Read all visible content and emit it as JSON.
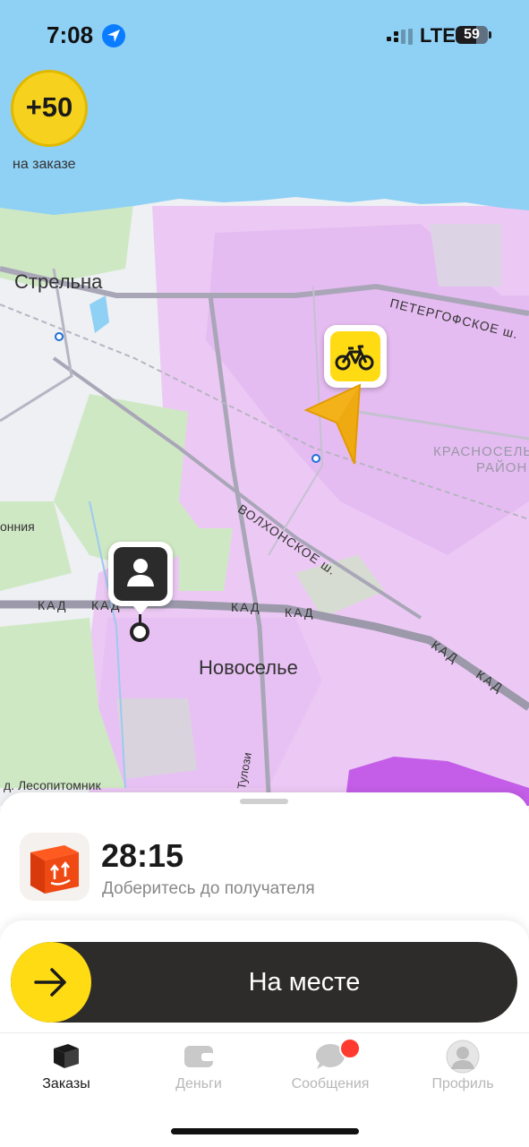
{
  "status_bar": {
    "time": "7:08",
    "network": "LTE",
    "battery": "59",
    "location_icon": "location-arrow-icon",
    "signal_icon": "signal-bars-icon"
  },
  "map": {
    "bonus": {
      "value": "+50",
      "label": "на заказе"
    },
    "places": {
      "strelna": "Стрельна",
      "novoselye": "Новоселье",
      "lesopitomnik": "д. Лесопитомник",
      "monia": "онния",
      "krasnoselsky_1": "КРАСНОСЕЛЬ",
      "krasnoselsky_2": "РАЙОН"
    },
    "roads": {
      "peterhof": "ПЕТЕРГОФСКОЕ ш.",
      "volkhon": "ВОЛХОНСКОЕ ш.",
      "kad": "КАД",
      "tulozi": "Тулози"
    },
    "markers": {
      "courier_icon": "bicycle-icon",
      "direction_icon": "navigation-arrow-icon",
      "recipient_icon": "person-icon"
    },
    "colors": {
      "water": "#8fd0f5",
      "zone": "#e8c3f3",
      "park": "#cfe8c4"
    }
  },
  "order": {
    "timer": "28:15",
    "subtitle": "Доберитесь до получателя",
    "icon": "parcel-box-icon"
  },
  "slider": {
    "label": "На месте",
    "icon": "arrow-right-icon",
    "accent": "#ffdb14"
  },
  "tabs": [
    {
      "label": "Заказы",
      "icon": "orders-box-icon",
      "active": true
    },
    {
      "label": "Деньги",
      "icon": "wallet-icon",
      "active": false
    },
    {
      "label": "Сообщения",
      "icon": "chat-bubble-icon",
      "active": false
    },
    {
      "label": "Профиль",
      "icon": "profile-avatar-icon",
      "active": false
    }
  ]
}
